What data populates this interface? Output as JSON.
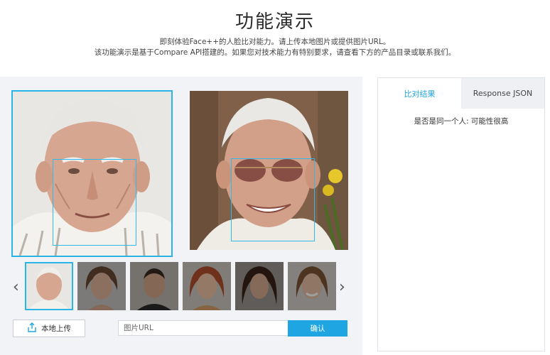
{
  "header": {
    "title": "功能演示",
    "intro_line1": "即刻体验Face++的人脸比对能力。请上传本地图片或提供图片URL。",
    "intro_line2": "该功能演示是基于Compare API搭建的。如果您对技术能力有特别要求，请查看下方的产品目录或联系我们。"
  },
  "gallery": {
    "prev_icon": "chevron-left-icon",
    "next_icon": "chevron-right-icon",
    "selected_index": 0,
    "thumbnail_count": 6
  },
  "controls": {
    "upload_label": "本地上传",
    "upload_icon": "upload-icon",
    "url_placeholder": "图片URL",
    "confirm_label": "确认"
  },
  "results": {
    "tabs": [
      {
        "label": "比对结果",
        "active": true
      },
      {
        "label": "Response JSON",
        "active": false
      }
    ],
    "verdict": "是否是同一个人: 可能性很高"
  },
  "colors": {
    "accent": "#1fa6e2",
    "face_box": "#31b9ea",
    "panel_bg": "#f1f3f6"
  }
}
